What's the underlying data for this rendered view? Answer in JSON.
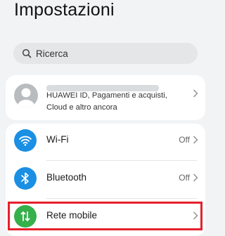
{
  "header": {
    "title": "Impostazioni"
  },
  "search": {
    "placeholder": "Ricerca"
  },
  "account": {
    "description_line1": "HUAWEI ID, Pagamenti e acquisti,",
    "description_line2": "Cloud e altro ancora"
  },
  "network": {
    "items": [
      {
        "label": "Wi-Fi",
        "value": "Off",
        "icon": "wifi-icon",
        "icon_color": "#1a8fe3"
      },
      {
        "label": "Bluetooth",
        "value": "Off",
        "icon": "bluetooth-icon",
        "icon_color": "#1a8fe3"
      },
      {
        "label": "Rete mobile",
        "value": "",
        "icon": "mobile-data-icon",
        "icon_color": "#36b04a"
      }
    ]
  },
  "colors": {
    "highlight": "#e5202b",
    "background": "#f1f3f5"
  }
}
